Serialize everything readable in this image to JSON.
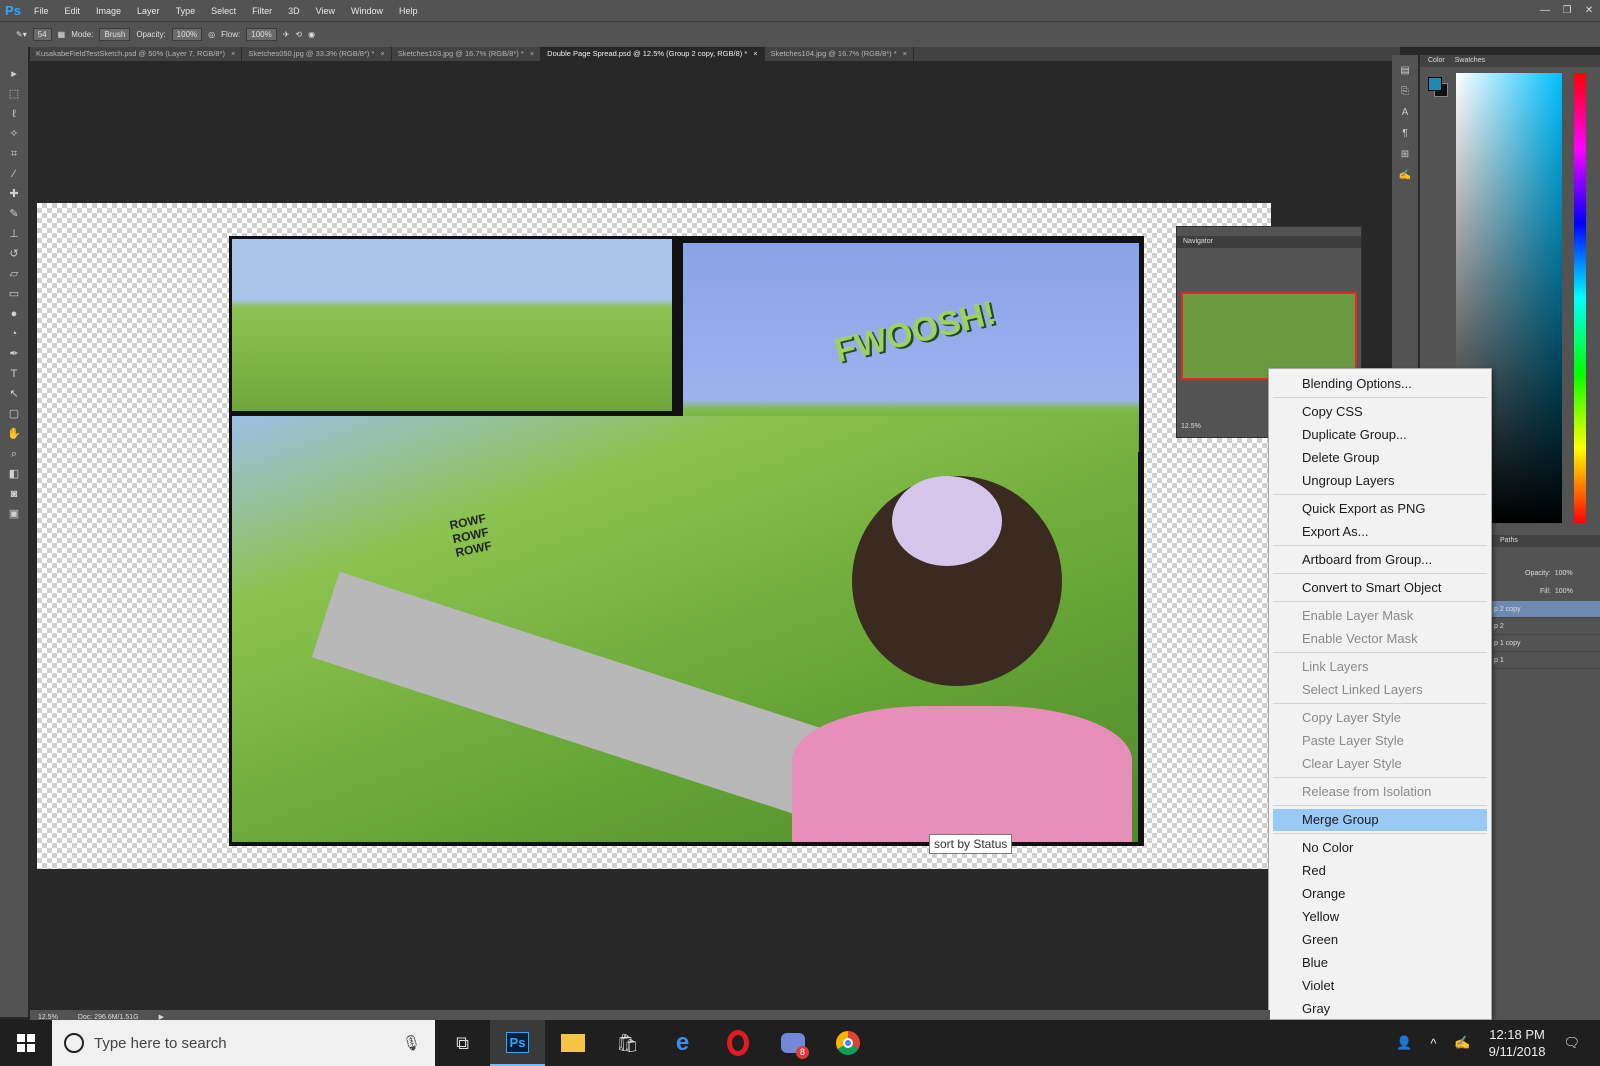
{
  "app": {
    "logo": "Ps"
  },
  "menubar": {
    "items": [
      "File",
      "Edit",
      "Image",
      "Layer",
      "Type",
      "Select",
      "Filter",
      "3D",
      "View",
      "Window",
      "Help"
    ]
  },
  "window_controls": {
    "minimize": "—",
    "restore": "❐",
    "close": "✕"
  },
  "options": {
    "brush_size": "54",
    "mode_label": "Mode:",
    "mode_value": "Brush",
    "opacity_label": "Opacity:",
    "opacity_value": "100%",
    "flow_label": "Flow:",
    "flow_value": "100%"
  },
  "tabs": [
    {
      "label": "KusakabeFieldTestSketch.psd @ 50% (Layer 7, RGB/8*)",
      "active": false
    },
    {
      "label": "Sketches050.jpg @ 33.3% (RGB/8*) *",
      "active": false
    },
    {
      "label": "Sketches103.jpg @ 16.7% (RGB/8*) *",
      "active": false
    },
    {
      "label": "Double Page Spread.psd @ 12.5% (Group 2 copy, RGB/8) *",
      "active": true
    },
    {
      "label": "Sketches104.jpg @ 16.7% (RGB/8*) *",
      "active": false
    }
  ],
  "comic": {
    "sfx_fwoosh": "FWOOSH!",
    "sfx_rowf": "ROWF ROWF ROWF"
  },
  "navigator": {
    "title": "Navigator",
    "zoom": "12.5%"
  },
  "color_panel": {
    "tab_color": "Color",
    "tab_swatches": "Swatches",
    "foreground": "#1d8ab6",
    "background": "#111111"
  },
  "layers_panel": {
    "tab": "Paths",
    "opacity_label": "Opacity:",
    "opacity_value": "100%",
    "fill_label": "Fill:",
    "fill_value": "100%",
    "rows": [
      "p 2 copy",
      "p 2",
      "p 1 copy",
      "p 1"
    ]
  },
  "context_menu": {
    "items": [
      {
        "label": "Blending Options...",
        "disabled": false
      },
      {
        "label": "Copy CSS",
        "disabled": false
      },
      {
        "label": "Duplicate Group...",
        "disabled": false
      },
      {
        "label": "Delete Group",
        "disabled": false
      },
      {
        "label": "Ungroup Layers",
        "disabled": false
      },
      {
        "label": "Quick Export as PNG",
        "disabled": false
      },
      {
        "label": "Export As...",
        "disabled": false
      },
      {
        "label": "Artboard from Group...",
        "disabled": false
      },
      {
        "label": "Convert to Smart Object",
        "disabled": false
      },
      {
        "label": "Enable Layer Mask",
        "disabled": true
      },
      {
        "label": "Enable Vector Mask",
        "disabled": true
      },
      {
        "label": "Link Layers",
        "disabled": true
      },
      {
        "label": "Select Linked Layers",
        "disabled": true
      },
      {
        "label": "Copy Layer Style",
        "disabled": true
      },
      {
        "label": "Paste Layer Style",
        "disabled": true
      },
      {
        "label": "Clear Layer Style",
        "disabled": true
      },
      {
        "label": "Release from Isolation",
        "disabled": true
      },
      {
        "label": "Merge Group",
        "disabled": false,
        "highlighted": true
      },
      {
        "label": "No Color",
        "disabled": false
      },
      {
        "label": "Red",
        "disabled": false
      },
      {
        "label": "Orange",
        "disabled": false
      },
      {
        "label": "Yellow",
        "disabled": false
      },
      {
        "label": "Green",
        "disabled": false
      },
      {
        "label": "Blue",
        "disabled": false
      },
      {
        "label": "Violet",
        "disabled": false
      },
      {
        "label": "Gray",
        "disabled": false
      }
    ]
  },
  "tooltip": {
    "text": "sort by Status"
  },
  "status": {
    "zoom": "12.5%",
    "doc": "Doc: 296.6M/1.51G"
  },
  "taskbar": {
    "search_placeholder": "Type here to search",
    "time": "12:18 PM",
    "date": "9/11/2018",
    "discord_badge": "8"
  }
}
